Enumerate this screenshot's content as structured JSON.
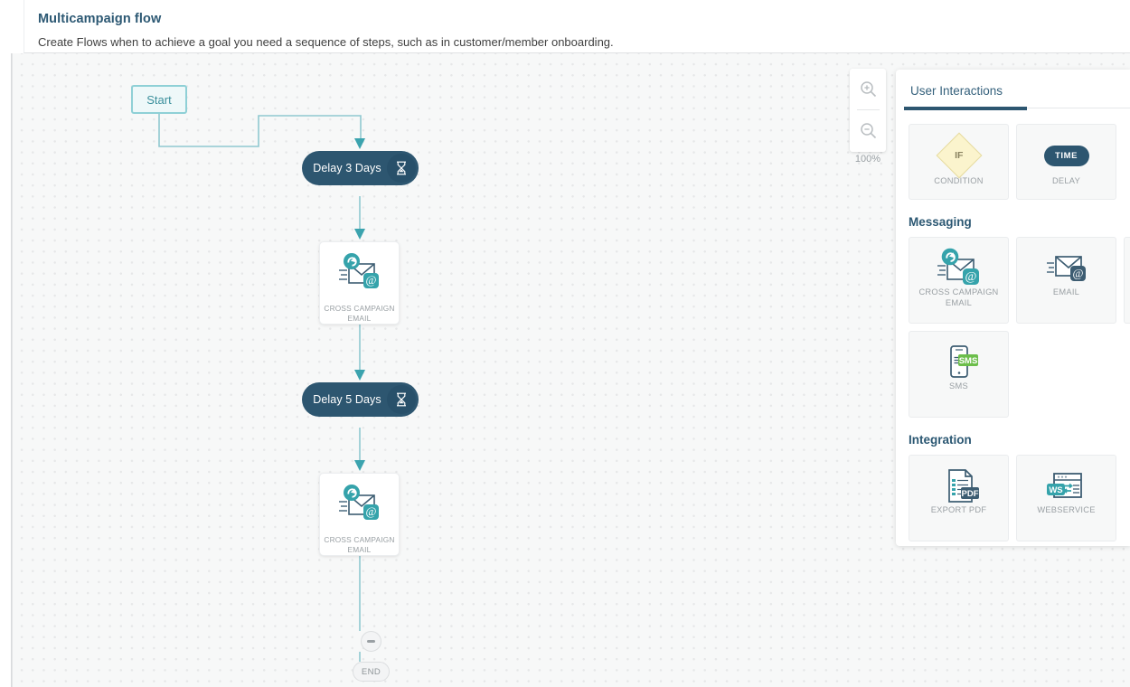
{
  "header": {
    "title": "Multicampaign flow",
    "subtitle": "Create Flows when to achieve a goal you need a sequence of steps, such as in customer/member onboarding."
  },
  "canvas": {
    "zoom": {
      "zoom_in_icon": "zoom-in-icon",
      "zoom_out_icon": "zoom-out-icon",
      "level": "100%"
    },
    "nodes": [
      {
        "id": "start",
        "type": "start",
        "label": "Start"
      },
      {
        "id": "delay1",
        "type": "delay",
        "label": "Delay 3 Days",
        "icon": "hourglass-icon"
      },
      {
        "id": "cce1",
        "type": "card",
        "label": "CROSS CAMPAIGN\nEMAIL",
        "icon": "cross-campaign-email-icon"
      },
      {
        "id": "delay2",
        "type": "delay",
        "label": "Delay 5 Days",
        "icon": "hourglass-icon"
      },
      {
        "id": "cce2",
        "type": "card",
        "label": "CROSS CAMPAIGN\nEMAIL",
        "icon": "cross-campaign-email-icon"
      },
      {
        "id": "collapse",
        "type": "minus",
        "label": "",
        "icon": "minus-icon"
      },
      {
        "id": "end",
        "type": "end",
        "label": "END"
      }
    ]
  },
  "panel": {
    "tabs": [
      {
        "id": "user-interactions",
        "label": "User Interactions",
        "active": true
      }
    ],
    "sections": [
      {
        "id": "top",
        "title": "",
        "tiles": [
          {
            "id": "condition",
            "label": "CONDITION",
            "icon": "condition-diamond-icon",
            "badge": "IF"
          },
          {
            "id": "delay",
            "label": "DELAY",
            "icon": "delay-pill-icon",
            "badge": "TIME"
          }
        ]
      },
      {
        "id": "messaging",
        "title": "Messaging",
        "tiles": [
          {
            "id": "cross-campaign-email",
            "label": "CROSS CAMPAIGN\nEMAIL",
            "icon": "cross-campaign-email-icon"
          },
          {
            "id": "email",
            "label": "EMAIL",
            "icon": "email-icon"
          },
          {
            "id": "partial",
            "label": "",
            "icon": ""
          }
        ]
      },
      {
        "id": "messaging-row2",
        "title": "",
        "tiles": [
          {
            "id": "sms",
            "label": "SMS",
            "icon": "sms-icon",
            "badge": "SMS"
          }
        ]
      },
      {
        "id": "integration",
        "title": "Integration",
        "tiles": [
          {
            "id": "export-pdf",
            "label": "EXPORT PDF",
            "icon": "pdf-icon",
            "badge": "PDF"
          },
          {
            "id": "webservice",
            "label": "WEBSERVICE",
            "icon": "webservice-icon",
            "badge": "WS"
          }
        ]
      }
    ]
  },
  "colors": {
    "brand_dark": "#2d5670",
    "teal": "#3ba3ae",
    "start_border": "#8fd0d6",
    "canvas_bg": "#f7f8f8",
    "green": "#6cbe4b",
    "yellow": "#fbf4cd"
  }
}
